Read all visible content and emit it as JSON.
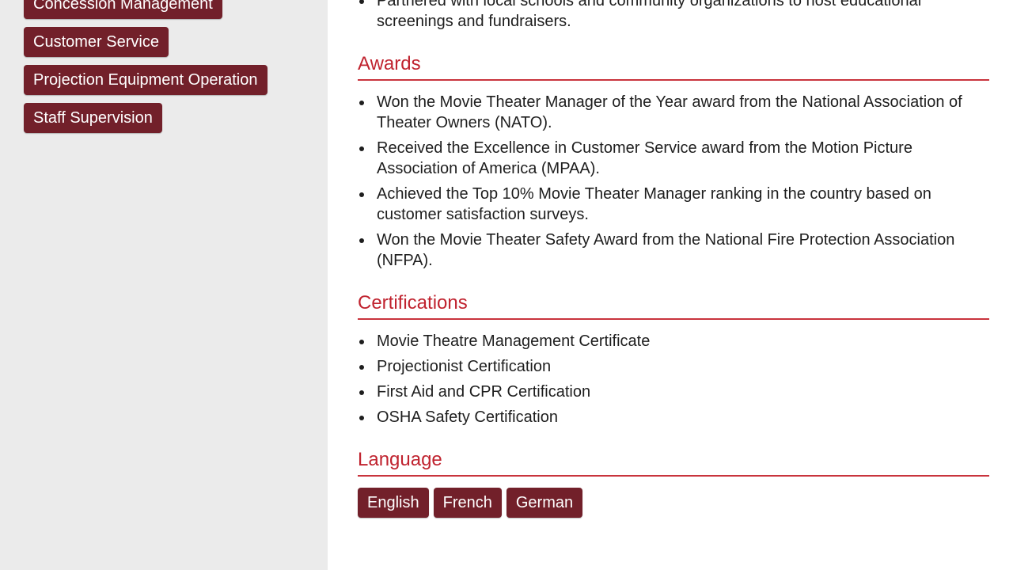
{
  "sidebar": {
    "skills": [
      "Concession Management",
      "Customer Service",
      "Projection Equipment Operation",
      "Staff Supervision"
    ]
  },
  "main": {
    "top_items": [
      "Partnered with local schools and community organizations to host educational screenings and fundraisers."
    ],
    "awards": {
      "title": "Awards",
      "items": [
        "Won the Movie Theater Manager of the Year award from the National Association of Theater Owners (NATO).",
        "Received the Excellence in Customer Service award from the Motion Picture Association of America (MPAA).",
        "Achieved the Top 10% Movie Theater Manager ranking in the country based on customer satisfaction surveys.",
        "Won the Movie Theater Safety Award from the National Fire Protection Association (NFPA)."
      ]
    },
    "certifications": {
      "title": "Certifications",
      "items": [
        "Movie Theatre Management Certificate",
        "Projectionist Certification",
        "First Aid and CPR Certification",
        "OSHA Safety Certification"
      ]
    },
    "language": {
      "title": "Language",
      "items": [
        "English",
        "French",
        "German"
      ]
    }
  },
  "colors": {
    "tag_background": "#72202a",
    "section_title": "#c0232f",
    "sidebar_background": "#ebebeb"
  }
}
